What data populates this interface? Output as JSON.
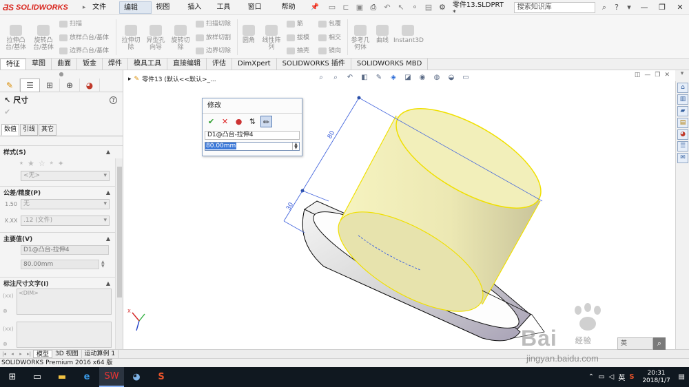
{
  "app": {
    "logo": "SOLIDWORKS",
    "menu": [
      "文件(F)",
      "编辑(E)",
      "视图(V)",
      "插入(I)",
      "工具(T)",
      "窗口(W)",
      "帮助(H)"
    ],
    "active_menu": "编辑(E)",
    "document": "零件13.SLDPRT *",
    "search_placeholder": "搜索知识库"
  },
  "ribbon": {
    "big_buttons": [
      {
        "label": "拉伸凸\n台/基体"
      },
      {
        "label": "旋转凸\n台/基体"
      },
      {
        "label": "拉伸切\n除"
      },
      {
        "label": "异型孔\n向导"
      },
      {
        "label": "旋转切\n除"
      },
      {
        "label": "圆角"
      },
      {
        "label": "线性阵\n列"
      },
      {
        "label": "参考几\n何体"
      },
      {
        "label": "曲线"
      },
      {
        "label": "Instant3D"
      }
    ],
    "small_buttons": [
      "扫描",
      "放样凸台/基体",
      "边界凸台/基体",
      "扫描切除",
      "放样切割",
      "边界切除",
      "筋",
      "拔模",
      "抽壳",
      "包覆",
      "相交",
      "镜向"
    ]
  },
  "command_tabs": [
    "特征",
    "草图",
    "曲面",
    "钣金",
    "焊件",
    "模具工具",
    "直接编辑",
    "评估",
    "DimXpert",
    "SOLIDWORKS 插件",
    "SOLIDWORKS MBD"
  ],
  "active_command_tab": "特征",
  "property_manager": {
    "title": "尺寸",
    "tabs": [
      "数值",
      "引线",
      "其它"
    ],
    "active_tab": "数值",
    "style_group": {
      "title": "样式(S)",
      "dropdown": "<无>"
    },
    "tolerance_group": {
      "title": "公差/精度(P)",
      "tolerance": "无",
      "precision": ".12 (文件)",
      "tol_icon_top": "1.50",
      "prec_icon_top": "X.XX"
    },
    "primary_group": {
      "title": "主要值(V)",
      "name": "D1@凸台-拉伸4",
      "value": "80.00mm"
    },
    "dim_text_group": {
      "title": "标注尺寸文字(I)",
      "text": "<DIM>"
    }
  },
  "viewport": {
    "breadcrumb": "零件13  (默认<<默认>_...",
    "dimension_80_label": "80",
    "dimension_30_label": "30"
  },
  "modify_dialog": {
    "title": "修改",
    "name": "D1@凸台-拉伸4",
    "value": "80.00mm"
  },
  "bottom_tabs": [
    "模型",
    "3D 视图",
    "运动算例 1"
  ],
  "active_bottom_tab": "模型",
  "status": "SOLIDWORKS Premium 2016 x64 版",
  "watermark": {
    "brand": "Bai",
    "brand_suffix": "经验",
    "url": "jingyan.baidu.com",
    "lang": "英"
  },
  "taskbar": {
    "ime": "英",
    "time": "20:31",
    "date": "2018/1/7"
  },
  "colors": {
    "accent": "#3b78d8",
    "cylinder": "#f2f0b0",
    "base": "#d6d6d6",
    "logo": "#d9251d"
  }
}
